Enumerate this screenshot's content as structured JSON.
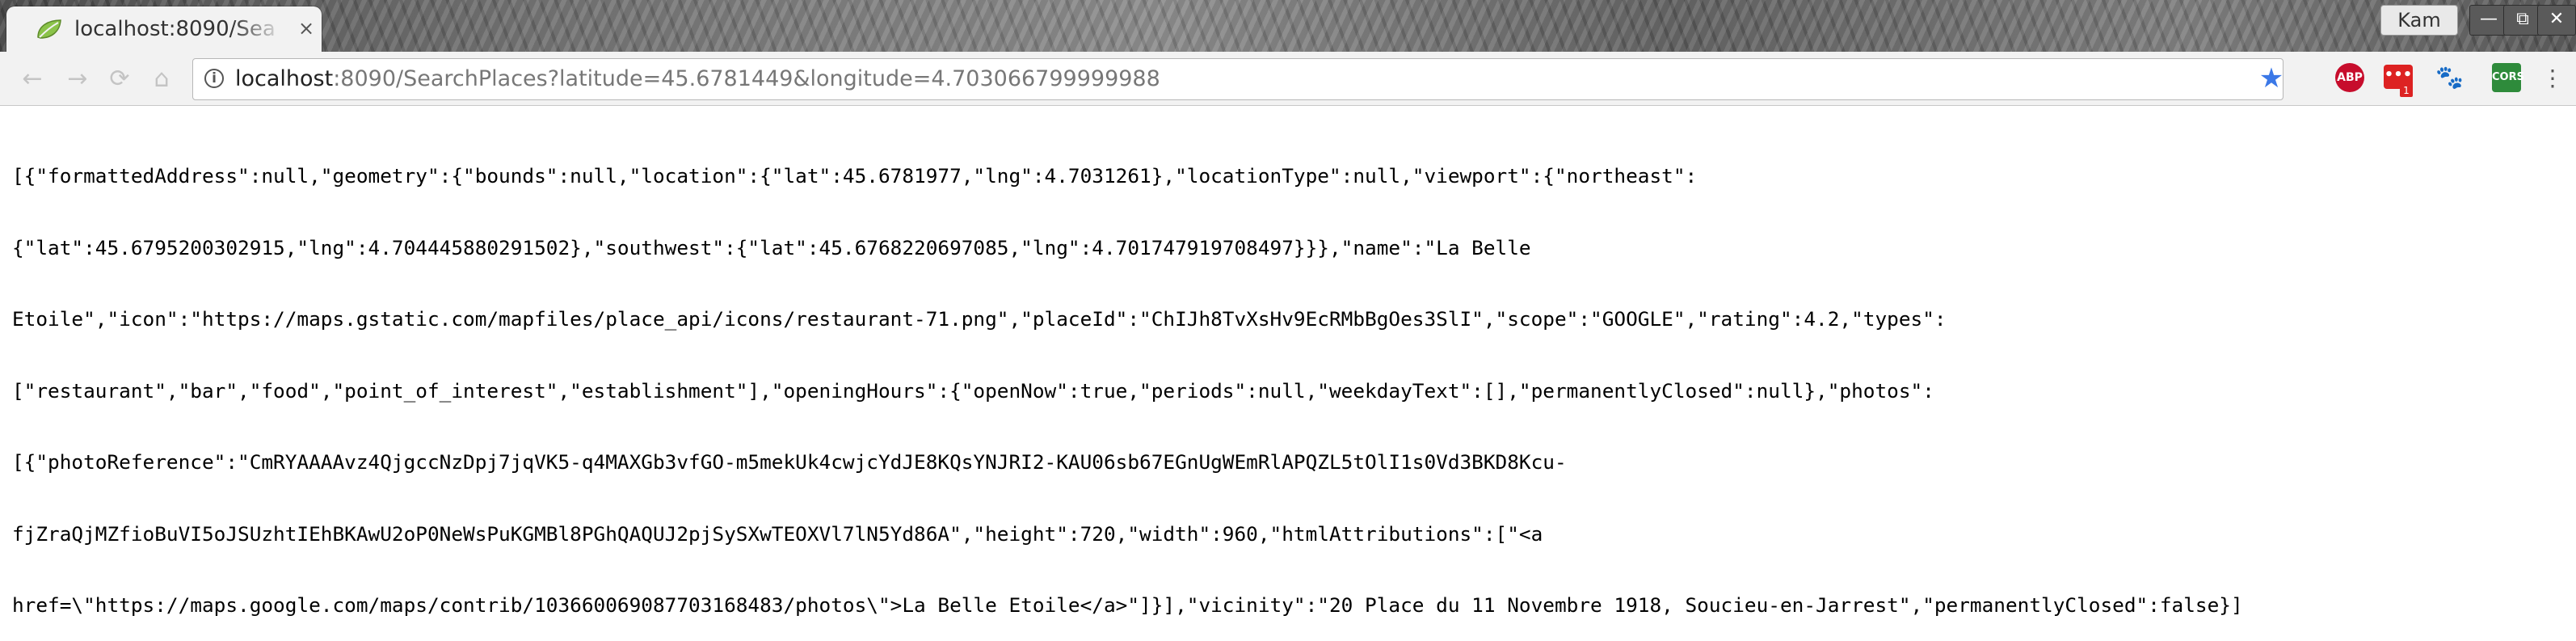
{
  "browser": {
    "tab": {
      "title": "localhost:8090/Sea",
      "close_glyph": "×"
    },
    "profile": "Kam",
    "window_controls": {
      "minimize": "—",
      "restore": "⧉",
      "close": "✕"
    },
    "nav": {
      "back": "←",
      "forward": "→",
      "reload": "⟳",
      "home": "⌂"
    },
    "omnibox": {
      "host": "localhost",
      "rest": ":8090/SearchPlaces?latitude=45.6781449&longitude=4.703066799999988"
    },
    "extensions": {
      "adblock": "ABP",
      "dots": "•••",
      "dots_badge": "1",
      "paw": "🐾",
      "cors": "CORS"
    },
    "menu_glyph": "⋮"
  },
  "page": {
    "json_lines": [
      "[{\"formattedAddress\":null,\"geometry\":{\"bounds\":null,\"location\":{\"lat\":45.6781977,\"lng\":4.7031261},\"locationType\":null,\"viewport\":{\"northeast\":",
      "{\"lat\":45.6795200302915,\"lng\":4.704445880291502},\"southwest\":{\"lat\":45.6768220697085,\"lng\":4.701747919708497}}},\"name\":\"La Belle",
      "Etoile\",\"icon\":\"https://maps.gstatic.com/mapfiles/place_api/icons/restaurant-71.png\",\"placeId\":\"ChIJh8TvXsHv9EcRMbBgOes3SlI\",\"scope\":\"GOOGLE\",\"rating\":4.2,\"types\":",
      "[\"restaurant\",\"bar\",\"food\",\"point_of_interest\",\"establishment\"],\"openingHours\":{\"openNow\":true,\"periods\":null,\"weekdayText\":[],\"permanentlyClosed\":null},\"photos\":",
      "[{\"photoReference\":\"CmRYAAAAvz4QjgccNzDpj7jqVK5-q4MAXGb3vfGO-m5mekUk4cwjcYdJE8KQsYNJRI2-KAU06sb67EGnUgWEmRlAPQZL5tOlI1s0Vd3BKD8Kcu-",
      "fjZraQjMZfioBuVI5oJSUzhtIEhBKAwU2oP0NeWsPuKGMBl8PGhQAQUJ2pjSySXwTEOXVl7lN5Yd86A\",\"height\":720,\"width\":960,\"htmlAttributions\":[\"<a",
      "href=\\\"https://maps.google.com/maps/contrib/103660069087703168483/photos\\\">La Belle Etoile</a>\"]}],\"vicinity\":\"20 Place du 11 Novembre 1918, Soucieu-en-Jarrest\",\"permanentlyClosed\":false}]"
    ]
  },
  "colors": {
    "star": "#3b78e7",
    "adblock": "#c70d2c",
    "cors": "#2e8b3b"
  }
}
